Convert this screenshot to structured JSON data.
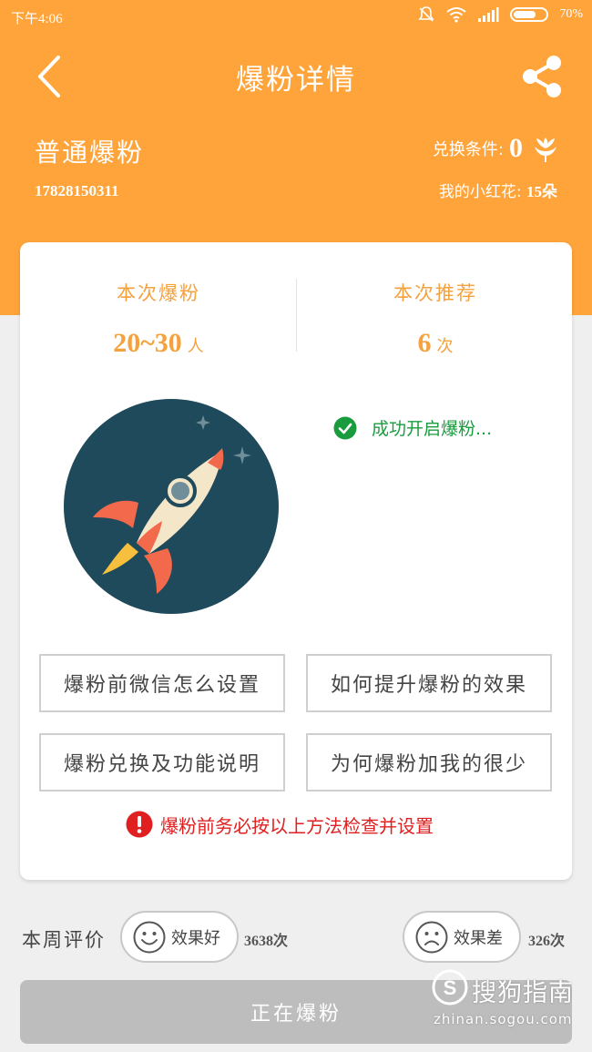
{
  "status_bar": {
    "time": "下午4:06",
    "battery": "70%",
    "battery_level": 0.7,
    "icons": [
      "mute-icon",
      "wifi-icon",
      "signal-icon",
      "battery-icon"
    ]
  },
  "nav": {
    "title": "爆粉详情",
    "back_icon": "chevron-left-icon",
    "share_icon": "share-icon"
  },
  "account": {
    "fan_type": "普通爆粉",
    "phone": "17828150311",
    "exchange_label": "兑换条件:",
    "exchange_value": "0",
    "exchange_icon": "flower-icon",
    "flowers_label": "我的小红花:",
    "flowers_count": "15朵"
  },
  "stats": {
    "fans_label": "本次爆粉",
    "fans_value": "20~30",
    "fans_unit": "人",
    "recommend_label": "本次推荐",
    "recommend_value": "6",
    "recommend_unit": "次"
  },
  "status": {
    "text": "成功开启爆粉...",
    "icon": "check-circle-icon"
  },
  "help_buttons": [
    "爆粉前微信怎么设置",
    "如何提升爆粉的效果",
    "爆粉兑换及功能说明",
    "为何爆粉加我的很少"
  ],
  "warning": {
    "text": "爆粉前务必按以上方法检查并设置",
    "icon": "exclamation-circle-icon"
  },
  "review": {
    "label": "本周评价",
    "good_label": "效果好",
    "good_count": "3638次",
    "bad_label": "效果差",
    "bad_count": "326次"
  },
  "action": {
    "label": "正在爆粉"
  },
  "watermark": {
    "text": "搜狗指南",
    "url": "zhinan.sogou.com"
  },
  "colors": {
    "header": "#ffa43a",
    "accent": "#f5a13d",
    "success": "#1a9c3e",
    "warning": "#e02020",
    "button_disabled": "#bdbdbd"
  }
}
